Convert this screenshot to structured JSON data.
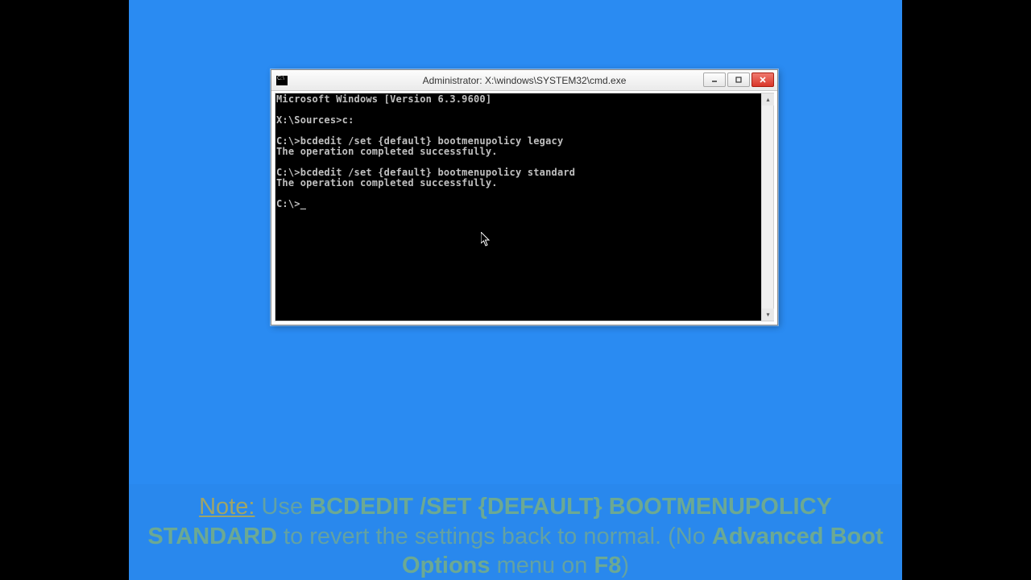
{
  "window": {
    "title": "Administrator: X:\\windows\\SYSTEM32\\cmd.exe"
  },
  "console": {
    "lines": [
      "Microsoft Windows [Version 6.3.9600]",
      "",
      "X:\\Sources>c:",
      "",
      "C:\\>bcdedit /set {default} bootmenupolicy legacy",
      "The operation completed successfully.",
      "",
      "C:\\>bcdedit /set {default} bootmenupolicy standard",
      "The operation completed successfully.",
      "",
      "C:\\>_"
    ]
  },
  "caption": {
    "note_label": "Note:",
    "pre": " Use ",
    "command": "BCDEDIT /SET {DEFAULT} BOOTMENUPOLICY STANDARD",
    "mid1": " to revert the settings back to normal. (No ",
    "kw": "Advanced Boot Options",
    "mid2": " menu on ",
    "key": "F8",
    "post": ")"
  }
}
